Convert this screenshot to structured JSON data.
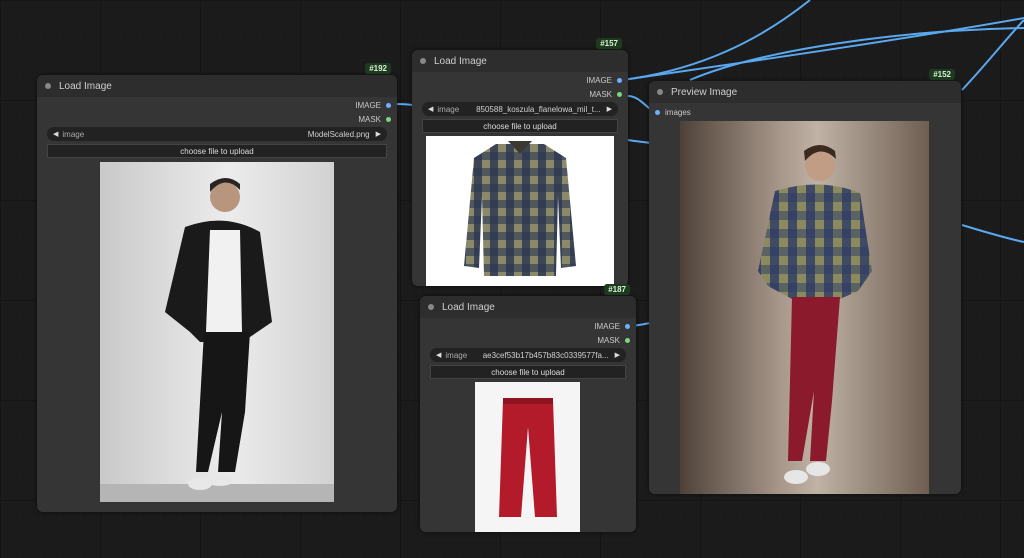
{
  "nodes": {
    "n192": {
      "badge": "#192",
      "title": "Load Image",
      "outputs": {
        "image": "IMAGE",
        "mask": "MASK"
      },
      "combo": {
        "label": "image",
        "value": "ModelScaled.png"
      },
      "upload_label": "choose file to upload"
    },
    "n157": {
      "badge": "#157",
      "title": "Load Image",
      "outputs": {
        "image": "IMAGE",
        "mask": "MASK"
      },
      "combo": {
        "label": "image",
        "value": "850588_koszula_flanelowa_mil_t..."
      },
      "upload_label": "choose file to upload"
    },
    "n187": {
      "badge": "#187",
      "title": "Load Image",
      "outputs": {
        "image": "IMAGE",
        "mask": "MASK"
      },
      "combo": {
        "label": "image",
        "value": "ae3cef53b17b457b83c0339577fa..."
      },
      "upload_label": "choose file to upload"
    },
    "n152": {
      "badge": "#152",
      "title": "Preview Image",
      "inputs": {
        "images": "images"
      }
    }
  },
  "colors": {
    "link_blue": "#5aa8f0",
    "socket_mask": "#7ed67e",
    "badge_bg": "#1e3a1e"
  },
  "icons": {
    "combo_left": "triangle-left-icon",
    "combo_right": "triangle-right-icon"
  }
}
